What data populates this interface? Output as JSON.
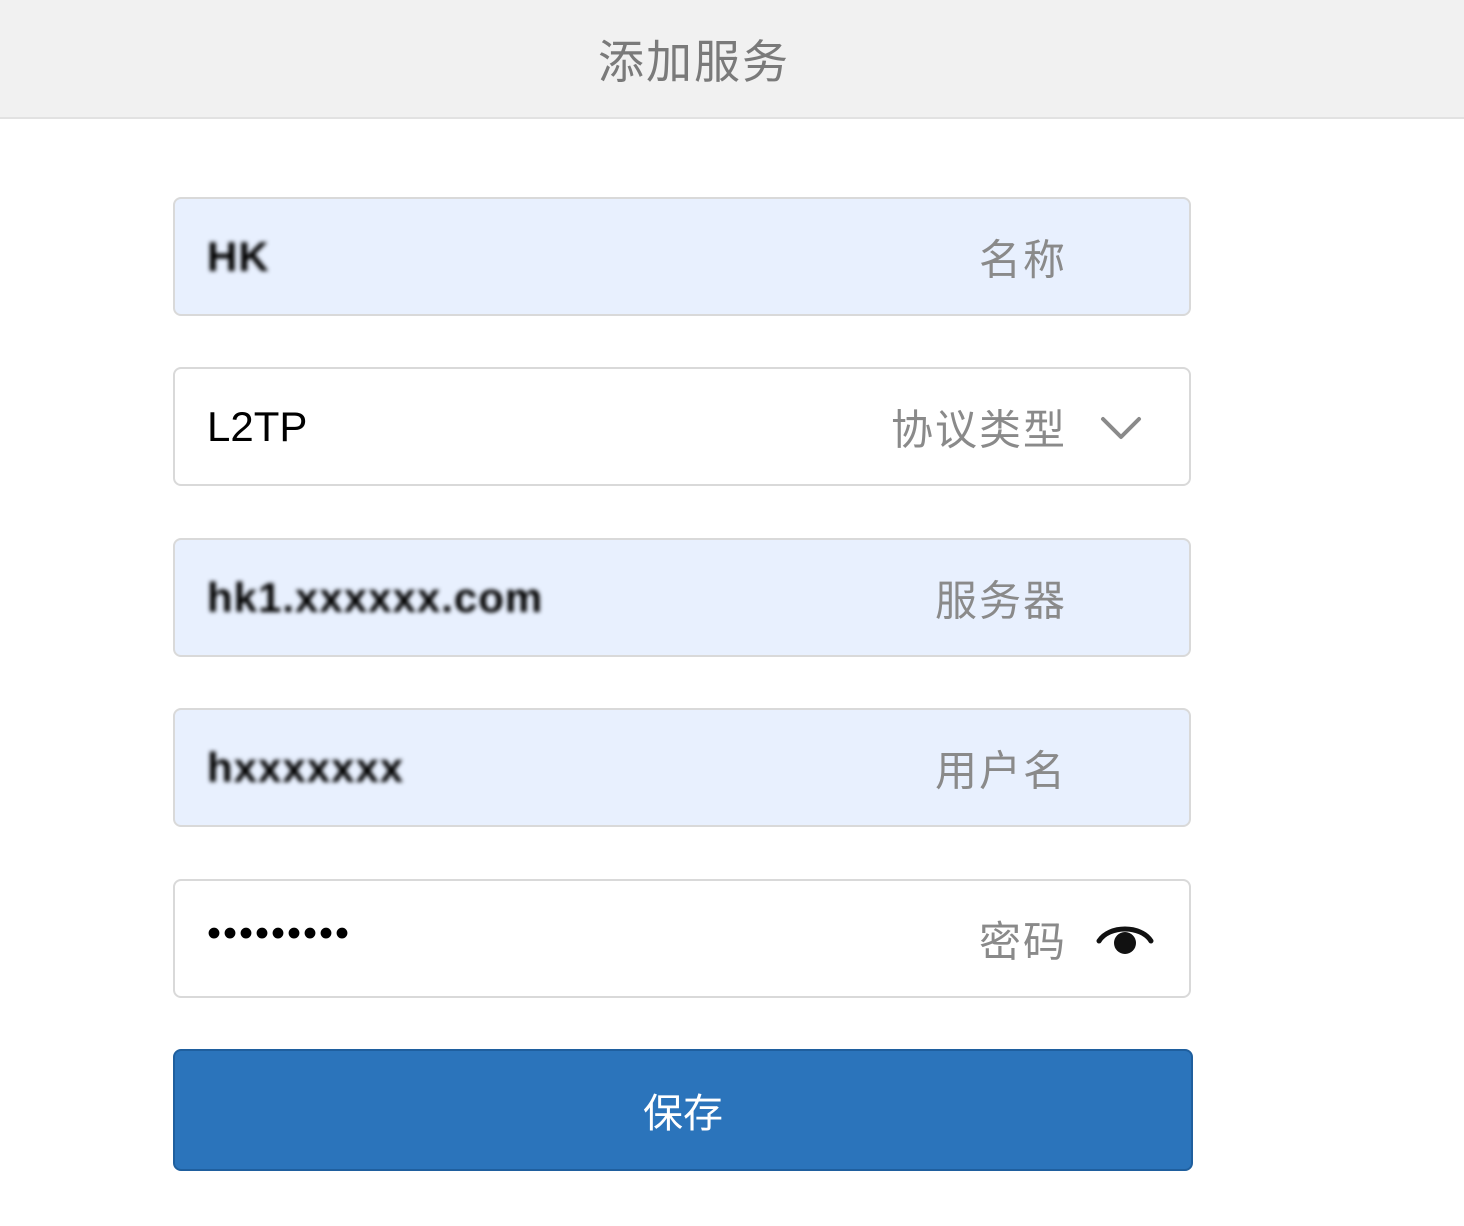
{
  "header": {
    "title": "添加服务"
  },
  "form": {
    "name": {
      "value": "HK",
      "label": "名称"
    },
    "protocol": {
      "value": "L2TP",
      "label": "协议类型",
      "icon": "chevron-down-icon"
    },
    "server": {
      "value": "hk1.xxxxxx.com",
      "label": "服务器"
    },
    "username": {
      "value": "hxxxxxxx",
      "label": "用户名"
    },
    "password": {
      "value": "•••••••••",
      "label": "密码",
      "icon": "eye-icon"
    }
  },
  "actions": {
    "save_label": "保存"
  },
  "colors": {
    "header_bg": "#f1f1f1",
    "filled_field_bg": "#e8f0fe",
    "primary_button": "#2b74bb",
    "label_gray": "#8a8a8a"
  }
}
